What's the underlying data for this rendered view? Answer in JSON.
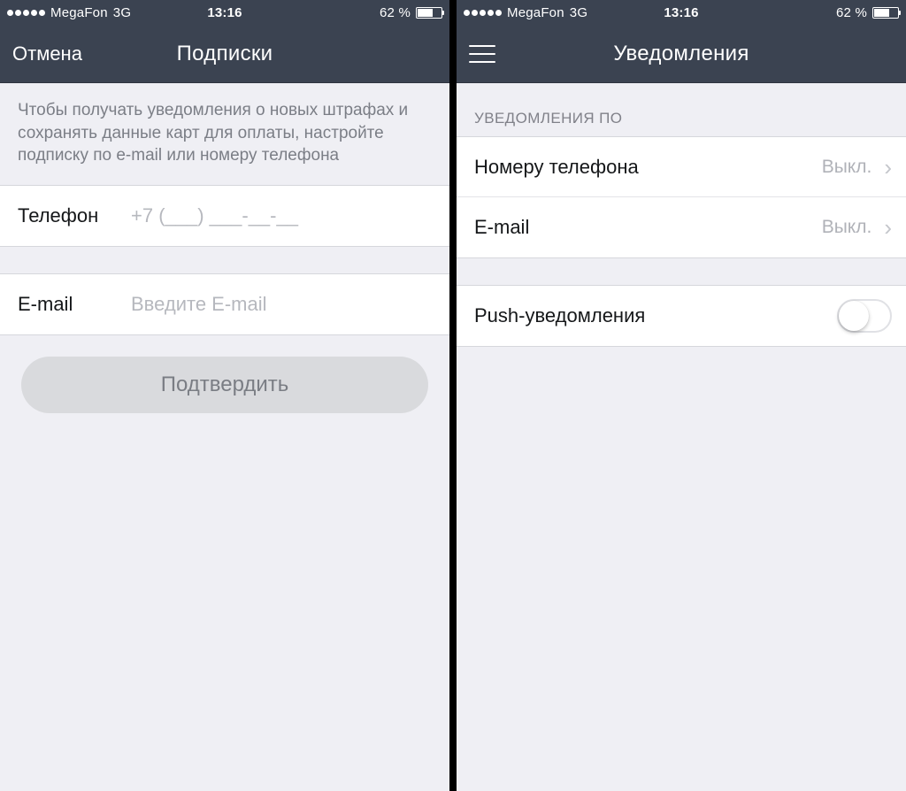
{
  "status": {
    "carrier": "MegaFon",
    "network": "3G",
    "time": "13:16",
    "battery_text": "62 %",
    "battery_level": 62
  },
  "left": {
    "nav": {
      "cancel": "Отмена",
      "title": "Подписки"
    },
    "intro": "Чтобы получать уведомления о новых штрафах и сохранять данные карт для оплаты, настройте подписку по e-mail или номеру телефона",
    "fields": {
      "phone_label": "Телефон",
      "phone_placeholder": "+7 (___) ___-__-__",
      "email_label": "E-mail",
      "email_placeholder": "Введите E-mail"
    },
    "confirm_button": "Подтвердить"
  },
  "right": {
    "nav": {
      "title": "Уведомления"
    },
    "section_header": "УВЕДОМЛЕНИЯ ПО",
    "items": {
      "phone": {
        "label": "Номеру телефона",
        "value": "Выкл."
      },
      "email": {
        "label": "E-mail",
        "value": "Выкл."
      },
      "push": {
        "label": "Push-уведомления",
        "on": false
      }
    }
  }
}
